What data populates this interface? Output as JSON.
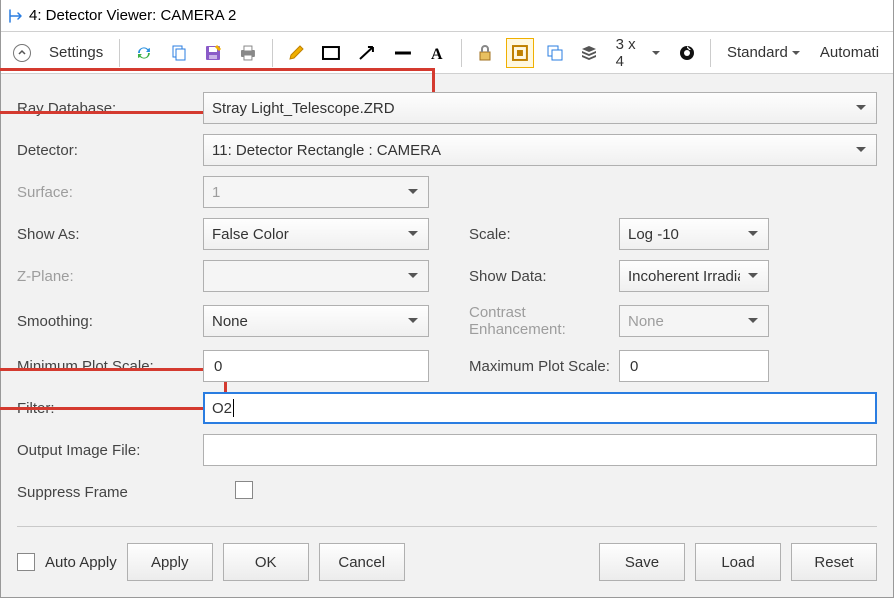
{
  "titlebar": {
    "text": "4: Detector Viewer: CAMERA 2"
  },
  "toolbar": {
    "settings_label": "Settings",
    "grid_label": "3 x 4",
    "standard_label": "Standard",
    "automatic_label": "Automati"
  },
  "form": {
    "ray_database_label": "Ray Database:",
    "ray_database_value": "Stray Light_Telescope.ZRD",
    "detector_label": "Detector:",
    "detector_value": "11: Detector Rectangle : CAMERA",
    "surface_label": "Surface:",
    "surface_value": "1",
    "show_as_label": "Show As:",
    "show_as_value": "False Color",
    "scale_label": "Scale:",
    "scale_value": "Log -10",
    "zplane_label": "Z-Plane:",
    "zplane_value": "",
    "show_data_label": "Show Data:",
    "show_data_value": "Incoherent Irradian",
    "smoothing_label": "Smoothing:",
    "smoothing_value": "None",
    "contrast_label": "Contrast Enhancement:",
    "contrast_value": "None",
    "min_plot_label": "Minimum Plot Scale:",
    "min_plot_value": "0",
    "max_plot_label": "Maximum Plot Scale:",
    "max_plot_value": "0",
    "filter_label": "Filter:",
    "filter_value": "O2",
    "output_file_label": "Output Image File:",
    "output_file_value": "",
    "suppress_frame_label": "Suppress Frame"
  },
  "buttons": {
    "auto_apply": "Auto Apply",
    "apply": "Apply",
    "ok": "OK",
    "cancel": "Cancel",
    "save": "Save",
    "load": "Load",
    "reset": "Reset"
  }
}
